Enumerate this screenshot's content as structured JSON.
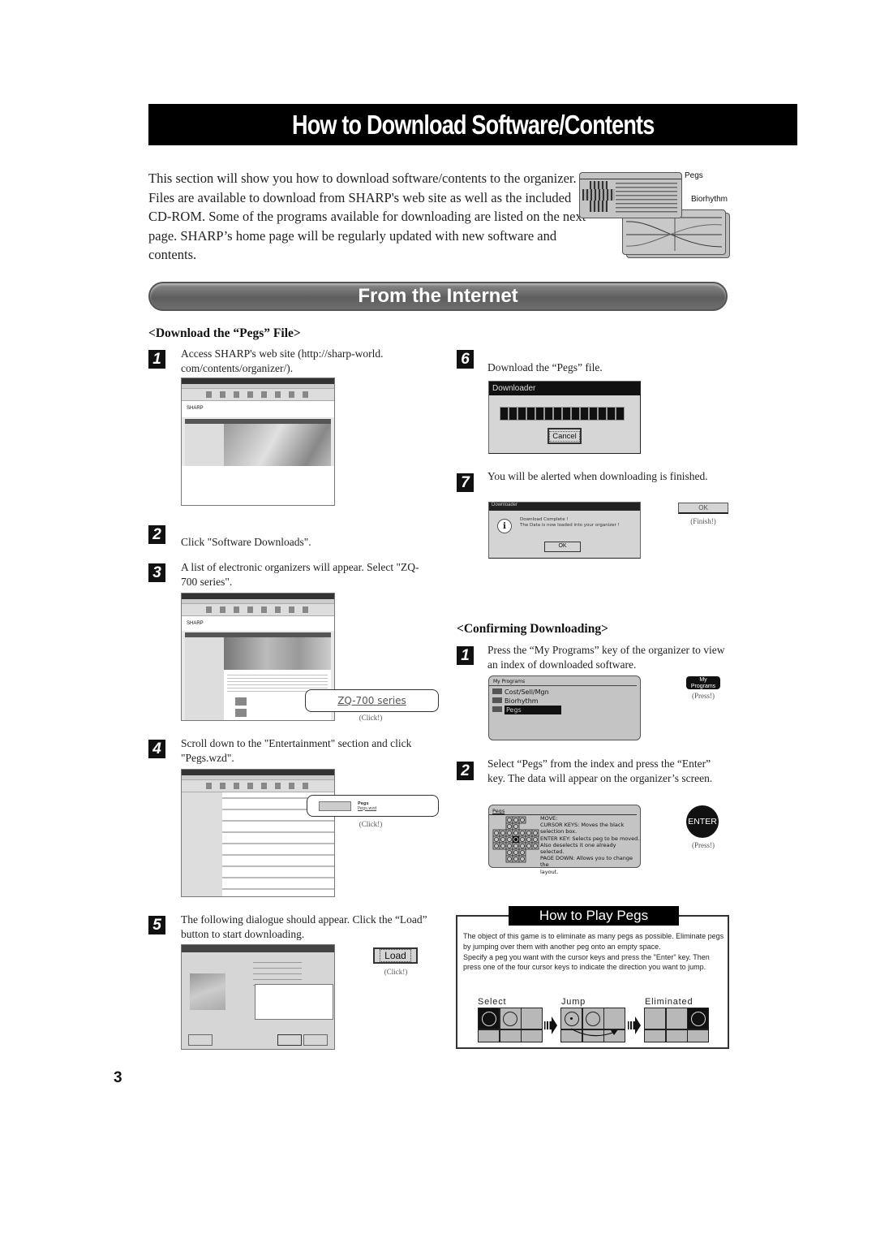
{
  "page": {
    "title": "How to Download Software/Contents",
    "intro": "This section will show you how to download software/contents to the organizer. Files are available to download from SHARP's web site as well as the included CD-ROM. Some of the programs available for downloading are listed on the next page. SHARP’s home page will be regularly updated with new software and contents.",
    "intro_labels": {
      "pegs": "Pegs",
      "biorhythm": "Biorhythm"
    },
    "page_number": "3"
  },
  "section": {
    "title": "From the Internet"
  },
  "download": {
    "heading": "<Download the “Pegs” File>",
    "steps": [
      {
        "num": "1",
        "text": "Access SHARP's web site (http://sharp-world. com/contents/organizer/)."
      },
      {
        "num": "2",
        "text": "Click \"Software Downloads\"."
      },
      {
        "num": "3",
        "text": "A list of electronic organizers will appear. Select \"ZQ-700 series\"."
      },
      {
        "num": "4",
        "text": "Scroll down to the \"Entertainment\" section and click \"Pegs.wzd\"."
      },
      {
        "num": "5",
        "text": "The following dialogue should appear. Click the “Load” button to start downloading."
      },
      {
        "num": "6",
        "text": "Download the “Pegs” file."
      },
      {
        "num": "7",
        "text": "You will be alerted when downloading is finished."
      }
    ],
    "callouts": {
      "zq700": "ZQ-700 series",
      "click": "(Click!)",
      "finish": "(Finish!)",
      "load": "Load",
      "ok": "OK",
      "pegs_link": "Pegs",
      "pegs_file": "Pegs.wzd"
    },
    "downloader": {
      "title": "Downloader",
      "cancel": "Cancel",
      "progress_blocks": 14
    },
    "complete_dialog": {
      "title": "Downloader",
      "line1": "Download Complete !",
      "line2": "The Data is now loaded into your organizer !",
      "ok": "OK"
    }
  },
  "confirm": {
    "heading": "<Confirming Downloading>",
    "steps": [
      {
        "num": "1",
        "text": "Press the “My Programs” key of the organizer to view an index of downloaded software."
      },
      {
        "num": "2",
        "text": "Select “Pegs” from the index and press the “Enter” key. The data will appear on the organizer’s screen."
      }
    ],
    "my_programs_screen": {
      "title": "My Programs",
      "items": [
        "Cost/Sell/Mgn",
        "Biorhythm",
        "Pegs"
      ]
    },
    "keys": {
      "my": "My",
      "programs": "Programs",
      "enter": "ENTER",
      "press": "(Press!)"
    },
    "pegs_screen": {
      "title": "Pegs",
      "lines": [
        "MOVE:",
        " CURSOR KEYS: Moves the black",
        " selection box.",
        " ENTER KEY: Selects peg to be moved.",
        " Also deselects it one already selected.",
        " PAGE DOWN: Allows you to change the",
        " layout."
      ]
    }
  },
  "howto": {
    "title": "How to Play Pegs",
    "para1": "The object of this game is to eliminate as many pegs as possible. Eliminate pegs by jumping over them with another peg onto an empty space.",
    "para2": "Specify a peg you want with the cursor keys and press the \"Enter\" key. Then press one of the four cursor keys to indicate the direction you want to jump.",
    "labels": [
      "Select",
      "Jump",
      "Eliminated"
    ]
  }
}
